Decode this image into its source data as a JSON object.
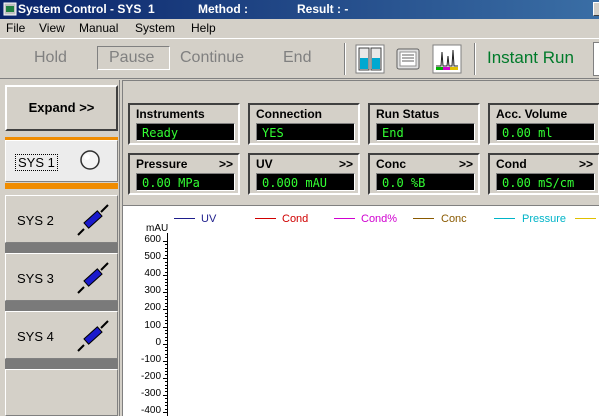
{
  "title": {
    "app": "System Control - SYS  1",
    "method": "Method :",
    "result": "Result : -"
  },
  "menu": [
    "File",
    "View",
    "Manual",
    "System",
    "Help"
  ],
  "toolbar": {
    "hold": "Hold",
    "pause": "Pause",
    "continue": "Continue",
    "end": "End",
    "instant_run": "Instant Run",
    "icons": [
      "column-view-icon",
      "document-icon",
      "chromatogram-icon"
    ]
  },
  "leftpanel": {
    "expand": "Expand >>",
    "systems": [
      {
        "label": "SYS 1",
        "icon": "light-bulb-icon",
        "selected": true
      },
      {
        "label": "SYS 2",
        "icon": "syringe-icon",
        "selected": false
      },
      {
        "label": "SYS 3",
        "icon": "syringe-icon",
        "selected": false
      },
      {
        "label": "SYS 4",
        "icon": "syringe-icon",
        "selected": false
      }
    ]
  },
  "status": {
    "instruments": {
      "label": "Instruments",
      "value": "Ready"
    },
    "connection": {
      "label": "Connection",
      "value": "YES"
    },
    "run_status": {
      "label": "Run Status",
      "value": "End"
    },
    "acc_volume": {
      "label": "Acc. Volume",
      "value": "0.00 ml"
    },
    "pressure": {
      "label": "Pressure",
      "arrow": ">>",
      "value": "0.00 MPa"
    },
    "uv": {
      "label": "UV",
      "arrow": ">>",
      "value": "0.000 mAU"
    },
    "conc": {
      "label": "Conc",
      "arrow": ">>",
      "value": "0.0 %B"
    },
    "cond": {
      "label": "Cond",
      "arrow": ">>",
      "value": "0.00 mS/cm"
    }
  },
  "chart_data": {
    "type": "line",
    "ylabel": "mAU",
    "yticks": [
      "600",
      "500",
      "400",
      "300",
      "200",
      "100",
      "0",
      "-100",
      "-200",
      "-300",
      "-400"
    ],
    "ylim": [
      -400,
      600
    ],
    "series": [
      {
        "name": "UV",
        "color": "#1e1e8c",
        "values": []
      },
      {
        "name": "Cond",
        "color": "#d00000",
        "values": []
      },
      {
        "name": "Cond%",
        "color": "#d000d0",
        "values": []
      },
      {
        "name": "Conc",
        "color": "#8a5a00",
        "values": []
      },
      {
        "name": "Pressure",
        "color": "#00b4c8",
        "values": []
      }
    ]
  },
  "colors": {
    "value_text": "#33ff33",
    "instant_run": "#007a2a",
    "orange_highlight": "#f08c00"
  }
}
